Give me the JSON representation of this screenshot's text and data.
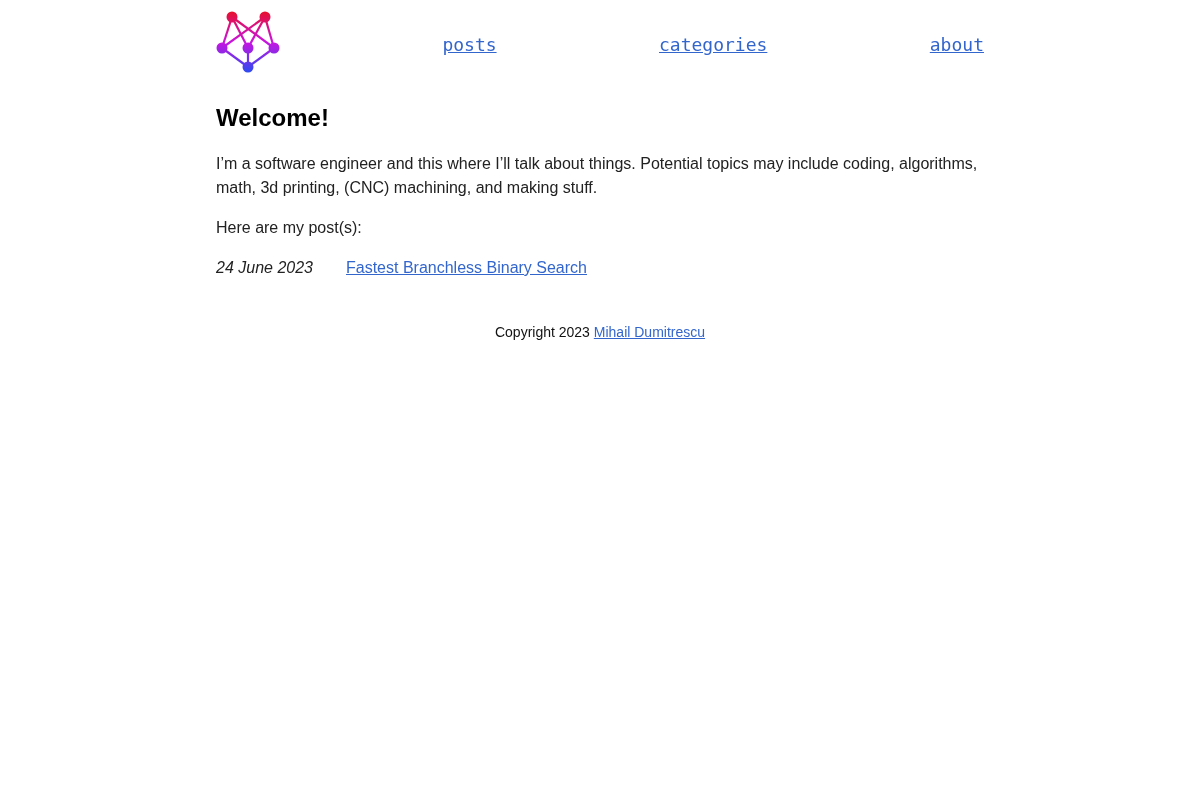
{
  "header": {
    "links": [
      {
        "label": "posts"
      },
      {
        "label": "categories"
      },
      {
        "label": "about"
      }
    ]
  },
  "main": {
    "title": "Welcome!",
    "intro": "I’m a software engineer and this where I’ll talk about things. Potential topics may include coding, algorithms, math, 3d printing, (CNC) machining, and making stuff.",
    "posts_heading": "Here are my post(s):",
    "posts": [
      {
        "date": "24 June 2023",
        "title": "Fastest Branchless Binary Search"
      }
    ]
  },
  "footer": {
    "text": "Copyright 2023",
    "link": "Mihail Dumitrescu"
  }
}
